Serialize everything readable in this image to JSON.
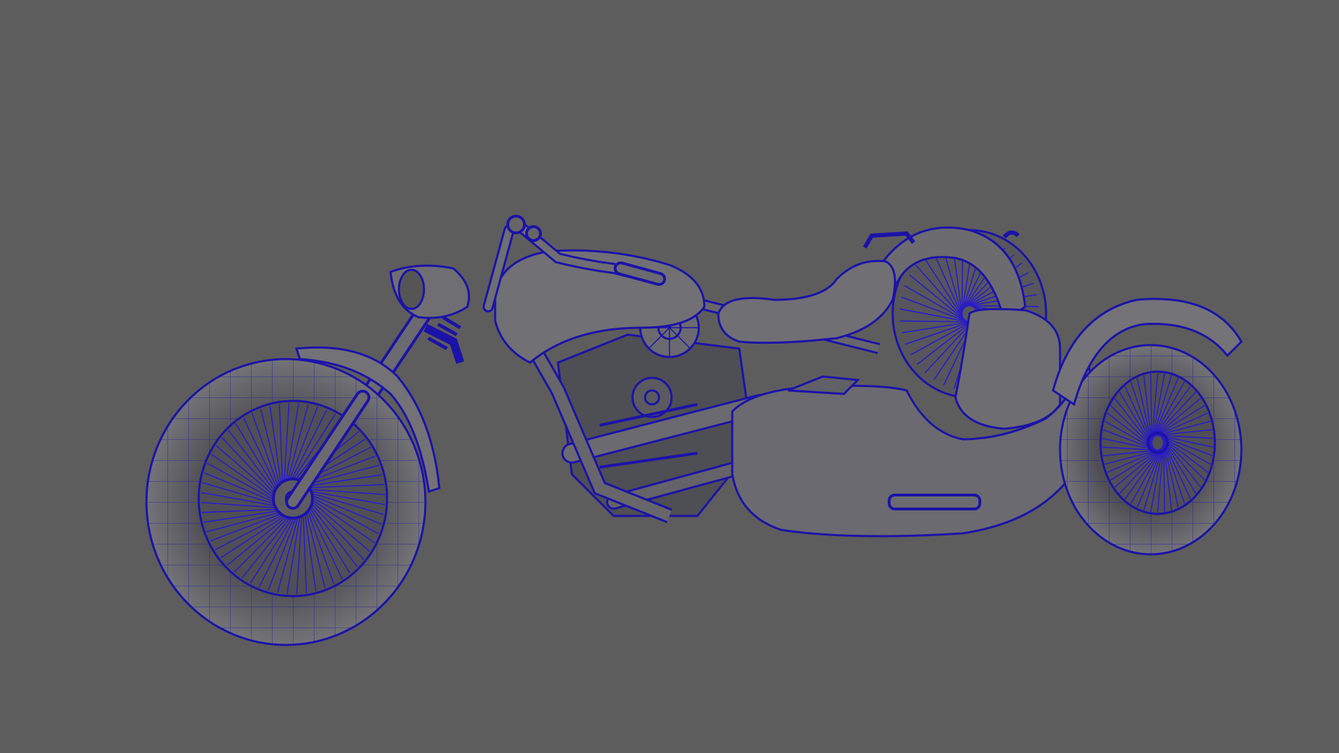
{
  "viewport": {
    "background_color": "#5d5d5d"
  },
  "model": {
    "shading_color": "#6e6e72",
    "shadow_color": "#4a4a50",
    "wireframe_color": "#1c12a8",
    "spoke_color": "#2a1cc8"
  }
}
